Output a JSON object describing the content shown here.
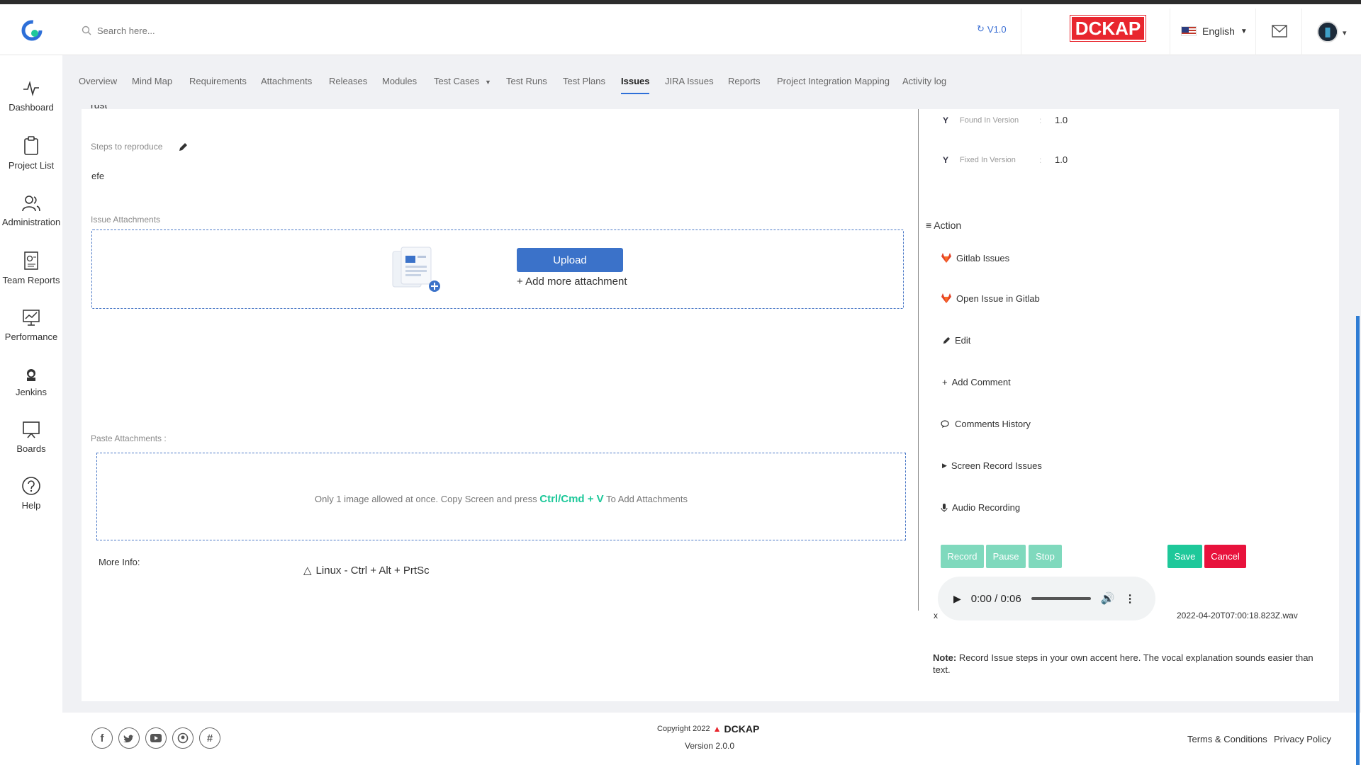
{
  "header": {
    "search_placeholder": "Search here...",
    "version": "V1.0",
    "brand": "DCKAP",
    "language": "English"
  },
  "sidebar": {
    "items": [
      {
        "label": "Dashboard",
        "icon": "pulse-icon"
      },
      {
        "label": "Project List",
        "icon": "clipboard-icon"
      },
      {
        "label": "Administration",
        "icon": "users-icon"
      },
      {
        "label": "Team Reports",
        "icon": "report-icon"
      },
      {
        "label": "Performance",
        "icon": "performance-icon"
      },
      {
        "label": "Jenkins",
        "icon": "jenkins-icon"
      },
      {
        "label": "Boards",
        "icon": "board-icon"
      },
      {
        "label": "Help",
        "icon": "help-icon"
      }
    ]
  },
  "tabs": [
    {
      "label": "Overview"
    },
    {
      "label": "Mind Map"
    },
    {
      "label": "Requirements"
    },
    {
      "label": "Attachments"
    },
    {
      "label": "Releases"
    },
    {
      "label": "Modules"
    },
    {
      "label": "Test Cases"
    },
    {
      "label": "Test Runs"
    },
    {
      "label": "Test Plans"
    },
    {
      "label": "Issues",
      "active": true
    },
    {
      "label": "JIRA Issues"
    },
    {
      "label": "Reports"
    },
    {
      "label": "Project Integration Mapping"
    },
    {
      "label": "Activity log"
    }
  ],
  "issue": {
    "cut_text": "rust",
    "steps_label": "Steps to reproduce",
    "steps_value": "efe",
    "attachments_label": "Issue Attachments",
    "upload_label": "Upload",
    "add_more_label": "+ Add more attachment",
    "paste_label": "Paste Attachments :",
    "paste_hint_pre": "Only 1 image allowed at once. Copy Screen and press",
    "paste_hint_key": "Ctrl/Cmd + V",
    "paste_hint_post": "To Add Attachments",
    "more_info_label": "More Info:",
    "linux_hint": "Linux - Ctrl + Alt + PrtSc"
  },
  "details": {
    "found_label": "Found In Version",
    "found_value": "1.0",
    "fixed_label": "Fixed In Version",
    "fixed_value": "1.0",
    "sep": ":"
  },
  "actions": {
    "header": "Action",
    "items": [
      {
        "label": "Gitlab Issues",
        "icon": "gitlab-icon"
      },
      {
        "label": "Open Issue in Gitlab",
        "icon": "gitlab-icon"
      },
      {
        "label": "Edit",
        "icon": "pencil-icon"
      },
      {
        "label": "Add Comment",
        "icon": "plus-icon"
      },
      {
        "label": "Comments History",
        "icon": "comments-icon"
      },
      {
        "label": "Screen Record Issues",
        "icon": "caret-right-icon"
      },
      {
        "label": "Audio Recording",
        "icon": "microphone-icon"
      }
    ]
  },
  "recorder": {
    "record": "Record",
    "pause": "Pause",
    "stop": "Stop",
    "save": "Save",
    "cancel": "Cancel",
    "time": "0:00 / 0:06",
    "close": "x",
    "filename": "2022-04-20T07:00:18.823Z.wav",
    "note_bold": "Note:",
    "note_text": " Record Issue steps in your own accent here. The vocal explanation sounds easier than text."
  },
  "footer": {
    "copyright": "Copyright 2022",
    "brand": "DCKAP",
    "version": "Version 2.0.0",
    "terms": "Terms & Conditions",
    "privacy": "Privacy Policy",
    "social": [
      "facebook-icon",
      "twitter-icon",
      "youtube-icon",
      "github-icon",
      "slack-icon"
    ]
  },
  "colors": {
    "accent": "#3b72c9",
    "green": "#1ec89a",
    "red": "#e8262e",
    "muted_green": "#7fd9bd"
  }
}
